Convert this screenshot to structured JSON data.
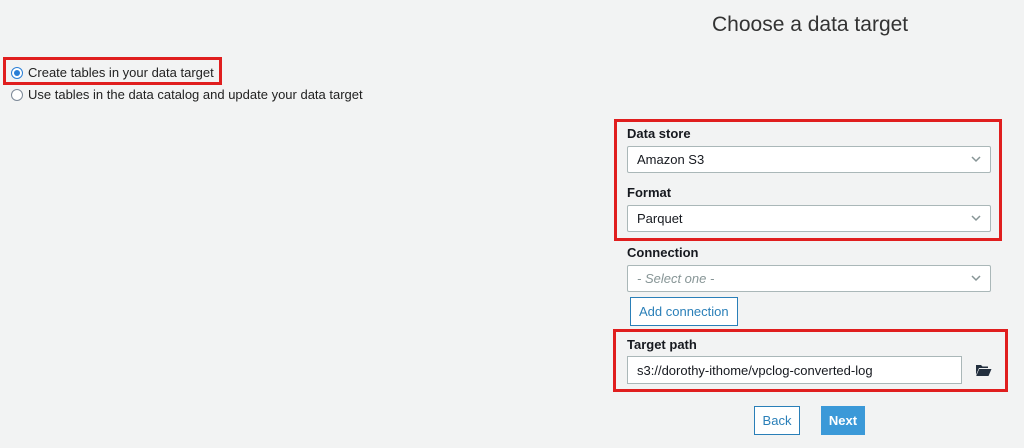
{
  "page_title": "Choose a data target",
  "options": {
    "create_tables": {
      "label": "Create tables in your data target",
      "selected": true
    },
    "use_catalog": {
      "label": "Use tables in the data catalog and update your data target",
      "selected": false
    }
  },
  "form": {
    "data_store": {
      "label": "Data store",
      "value": "Amazon S3"
    },
    "format": {
      "label": "Format",
      "value": "Parquet"
    },
    "connection": {
      "label": "Connection",
      "placeholder": "- Select one -"
    },
    "add_connection_label": "Add connection",
    "target_path": {
      "label": "Target path",
      "value": "s3://dorothy-ithome/vpclog-converted-log"
    }
  },
  "buttons": {
    "back": "Back",
    "next": "Next"
  },
  "icons": {
    "chevron": "chevron-down-icon",
    "folder": "folder-open-icon",
    "radio_selected": "radio-selected-icon",
    "radio_unselected": "radio-unselected-icon"
  },
  "colors": {
    "highlight": "#e01e1e",
    "primary_button": "#3b99d8",
    "link_blue": "#2a7fb8",
    "radio_accent": "#2a7fd6",
    "background": "#f2f3f3"
  }
}
